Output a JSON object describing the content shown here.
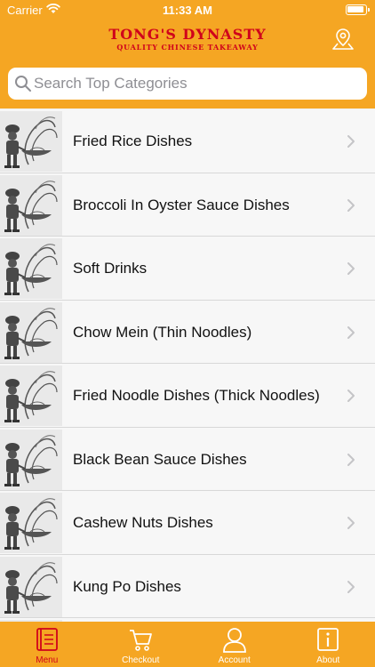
{
  "status_bar": {
    "carrier": "Carrier",
    "time": "11:33 AM"
  },
  "header": {
    "brand_title": "TONG'S DYNASTY",
    "brand_subtitle": "QUALITY CHINESE TAKEAWAY",
    "location_icon": "location-pin-icon"
  },
  "search": {
    "placeholder": "Search Top Categories",
    "value": ""
  },
  "categories": [
    {
      "label": "Fried Rice Dishes"
    },
    {
      "label": "Broccoli In Oyster Sauce Dishes"
    },
    {
      "label": "Soft Drinks"
    },
    {
      "label": "Chow Mein (Thin Noodles)"
    },
    {
      "label": "Fried Noodle Dishes (Thick Noodles)"
    },
    {
      "label": "Black Bean Sauce Dishes"
    },
    {
      "label": "Cashew Nuts Dishes"
    },
    {
      "label": "Kung Po Dishes"
    },
    {
      "label": ""
    }
  ],
  "tabs": [
    {
      "label": "Menu",
      "icon": "menu-book-icon",
      "active": true
    },
    {
      "label": "Checkout",
      "icon": "cart-icon",
      "active": false
    },
    {
      "label": "Account",
      "icon": "user-icon",
      "active": false
    },
    {
      "label": "About",
      "icon": "info-icon",
      "active": false
    }
  ],
  "colors": {
    "primary": "#f5a623",
    "brand_red": "#d0021b",
    "background": "#f7f7f7"
  }
}
